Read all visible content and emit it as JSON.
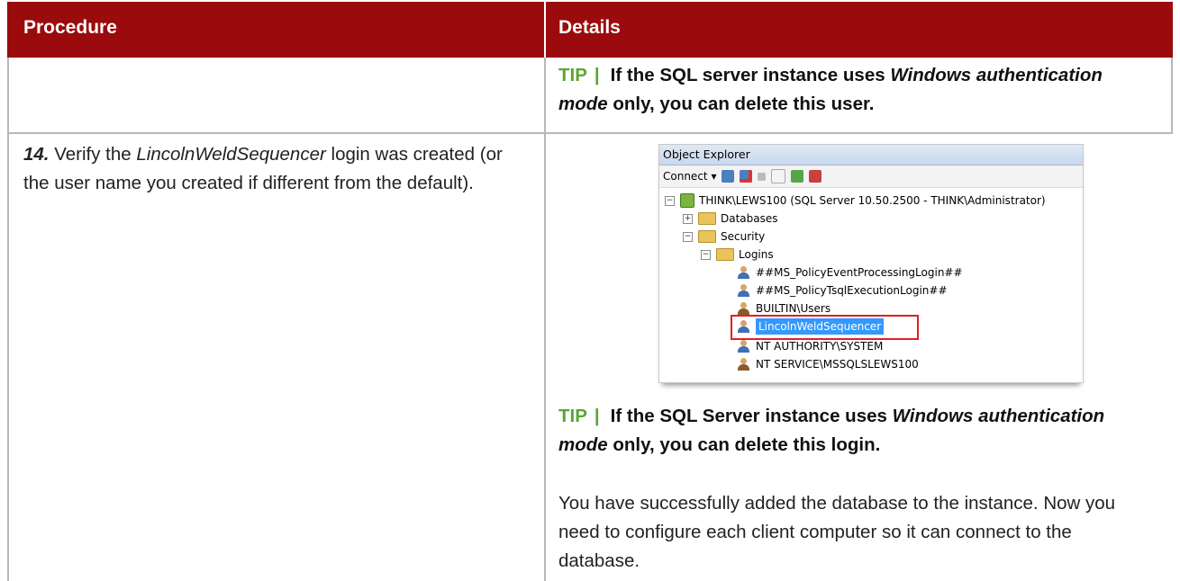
{
  "table": {
    "headers": [
      "Procedure",
      "Details"
    ]
  },
  "row1": {
    "tip": {
      "label": "TIP",
      "separator": "|",
      "text_before": "If the SQL server instance uses ",
      "text_italic": "Windows authentication mode",
      "text_after": " only, you can delete this user."
    }
  },
  "row2": {
    "step": {
      "number": "14.",
      "text_before": " Verify the ",
      "text_italic": "LincolnWeldSequencer",
      "text_after": " login was created (or the user name you created if different from the default)."
    },
    "object_explorer": {
      "title": "Object Explorer",
      "connect_label": "Connect",
      "connect_arrow": "▾",
      "toolbar_icons": [
        "connect-icon",
        "disconnect-icon",
        "stop-icon",
        "filter-icon",
        "refresh-icon",
        "summary-icon"
      ],
      "tree": [
        {
          "label": "THINK\\LEWS100 (SQL Server 10.50.2500 - THINK\\Administrator)",
          "type": "server",
          "expander": "−"
        },
        {
          "label": "Databases",
          "type": "folder",
          "expander": "+"
        },
        {
          "label": "Security",
          "type": "folder",
          "expander": "−"
        },
        {
          "label": "Logins",
          "type": "folder",
          "expander": "−"
        },
        {
          "label": "##MS_PolicyEventProcessingLogin##",
          "type": "login"
        },
        {
          "label": "##MS_PolicyTsqlExecutionLogin##",
          "type": "login"
        },
        {
          "label": "BUILTIN\\Users",
          "type": "group"
        },
        {
          "label": "LincolnWeldSequencer",
          "type": "login",
          "selected": true
        },
        {
          "label": "NT AUTHORITY\\SYSTEM",
          "type": "login"
        },
        {
          "label": "NT SERVICE\\MSSQLSLEWS100",
          "type": "group"
        }
      ]
    },
    "tip": {
      "label": "TIP",
      "separator": "|",
      "text_before": "If the SQL Server instance uses ",
      "text_italic": "Windows authentication mode",
      "text_after": " only, you can delete this login."
    },
    "paragraph": "You have successfully added the database to the instance.  Now you need to configure each client computer so it can connect to the database."
  },
  "colors": {
    "header_bg": "#9b0a0c",
    "tip_accent": "#5aa532",
    "selection": "#3399ff",
    "highlight_box": "#e02020"
  }
}
